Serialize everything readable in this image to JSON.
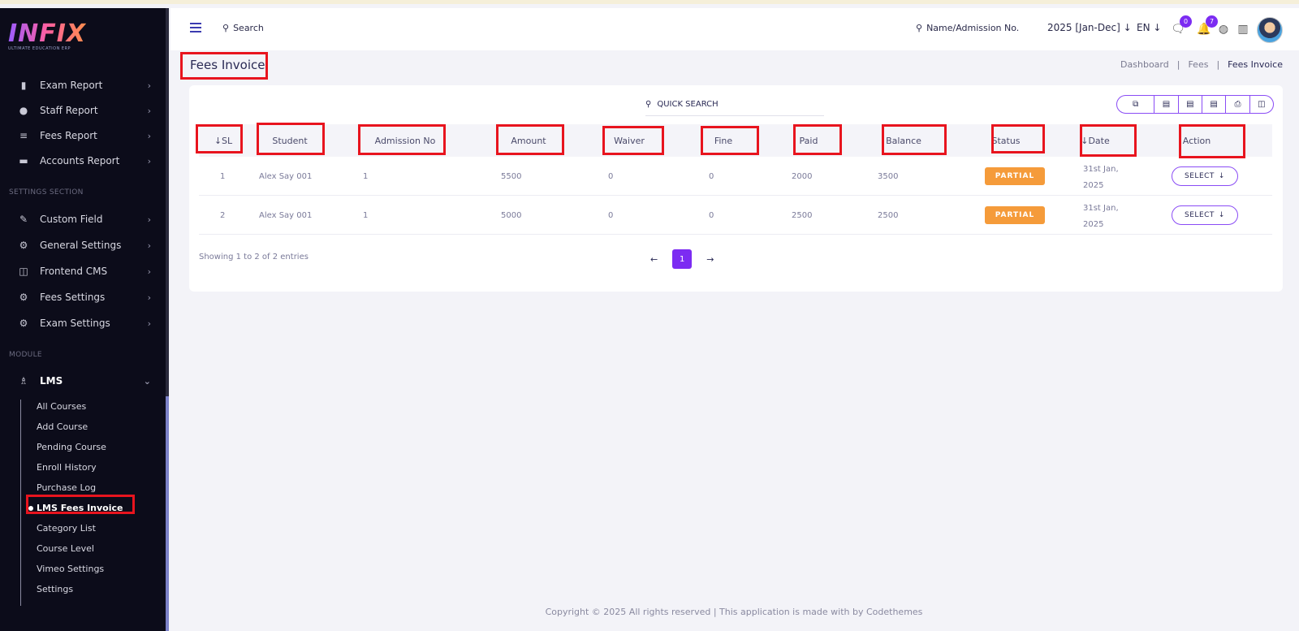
{
  "brand": {
    "logo_text": "INFIX",
    "tagline": "ULTIMATE EDUCATION ERP"
  },
  "sidebar": {
    "report_items": [
      {
        "label": "Exam Report",
        "icon": "book-icon"
      },
      {
        "label": "Staff Report",
        "icon": "user-icon"
      },
      {
        "label": "Fees Report",
        "icon": "list-icon"
      },
      {
        "label": "Accounts Report",
        "icon": "money-icon"
      }
    ],
    "settings_section_label": "SETTINGS SECTION",
    "settings_items": [
      {
        "label": "Custom Field",
        "icon": "custom-field-icon"
      },
      {
        "label": "General Settings",
        "icon": "gears-icon"
      },
      {
        "label": "Frontend CMS",
        "icon": "cms-icon"
      },
      {
        "label": "Fees Settings",
        "icon": "gears-icon"
      },
      {
        "label": "Exam Settings",
        "icon": "gears-icon"
      }
    ],
    "module_section_label": "MODULE",
    "module_item": {
      "label": "LMS",
      "icon": "lms-icon"
    },
    "lms_subitems": [
      "All Courses",
      "Add Course",
      "Pending Course",
      "Enroll History",
      "Purchase Log",
      "LMS Fees Invoice",
      "Category List",
      "Course Level",
      "Vimeo Settings",
      "Settings"
    ],
    "active_subitem": "LMS Fees Invoice"
  },
  "topbar": {
    "search_label": "Search",
    "student_search_label": "Name/Admission No.",
    "session": "2025 [Jan-Dec]",
    "language": "EN",
    "messages_count": "0",
    "notifications_count": "7"
  },
  "page": {
    "title": "Fees Invoice",
    "breadcrumb": [
      "Dashboard",
      "Fees",
      "Fees Invoice"
    ]
  },
  "table": {
    "quick_search_label": "QUICK SEARCH",
    "columns": [
      "SL",
      "Student",
      "Admission No",
      "Amount",
      "Waiver",
      "Fine",
      "Paid",
      "Balance",
      "Status",
      "Date",
      "Action"
    ],
    "rows": [
      {
        "sl": "1",
        "student": "Alex Say 001",
        "admission_no": "1",
        "amount": "5500",
        "waiver": "0",
        "fine": "0",
        "paid": "2000",
        "balance": "3500",
        "status": "PARTIAL",
        "date_line1": "31st Jan,",
        "date_line2": "2025",
        "action": "SELECT"
      },
      {
        "sl": "2",
        "student": "Alex Say 001",
        "admission_no": "1",
        "amount": "5000",
        "waiver": "0",
        "fine": "0",
        "paid": "2500",
        "balance": "2500",
        "status": "PARTIAL",
        "date_line1": "31st Jan,",
        "date_line2": "2025",
        "action": "SELECT"
      }
    ],
    "showing_text": "Showing 1 to 2 of 2 entries",
    "current_page": "1"
  },
  "footer": {
    "text": "Copyright © 2025 All rights reserved | This application is made with by Codethemes"
  },
  "colors": {
    "accent": "#7c2cf2",
    "status_partial": "#f59b3a",
    "sidebar_bg": "#0c0c1a",
    "highlight": "#e8141e"
  }
}
